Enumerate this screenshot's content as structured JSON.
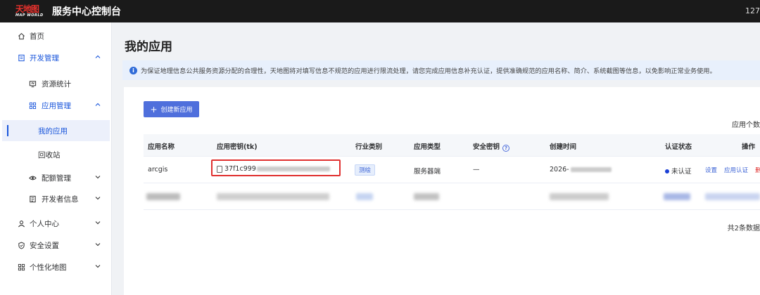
{
  "header": {
    "logo_main": "天地图",
    "logo_sub": "MAP WORLD",
    "app_title": "服务中心控制台",
    "right_text": "127"
  },
  "sidebar": {
    "home": "首页",
    "dev_manage": "开发管理",
    "resource_stats": "资源统计",
    "app_manage": "应用管理",
    "my_apps": "我的应用",
    "recycle_bin": "回收站",
    "quota_manage": "配额管理",
    "developer_info": "开发者信息",
    "personal_center": "个人中心",
    "security_settings": "安全设置",
    "custom_map": "个性化地图"
  },
  "page": {
    "title": "我的应用",
    "notice": "为保证地理信息公共服务资源分配的合理性，天地图将对填写信息不规范的应用进行限流处理，请您完成应用信息补充认证，提供准确规范的应用名称、简介、系统截图等信息，以免影响正常业务使用。"
  },
  "toolbar": {
    "create_label": "创建新应用",
    "count_label": "应用个数"
  },
  "table": {
    "headers": {
      "app_name": "应用名称",
      "app_key": "应用密钥(tk)",
      "industry": "行业类别",
      "app_type": "应用类型",
      "security_key": "安全密钥",
      "created_time": "创建时间",
      "auth_status": "认证状态",
      "actions": "操作"
    },
    "rows": [
      {
        "name": "arcgis",
        "key_prefix": "37f1c999",
        "industry": "测绘",
        "type": "服务器端",
        "security_key": "—",
        "created_prefix": "2026-",
        "status": "未认证",
        "action_settings": "设置",
        "action_auth": "应用认证",
        "action_delete": "删除"
      }
    ],
    "total": "共2条数据"
  },
  "colors": {
    "accent": "#4f6fdc",
    "danger": "#e0302f",
    "topbar": "#1a1a1a"
  }
}
